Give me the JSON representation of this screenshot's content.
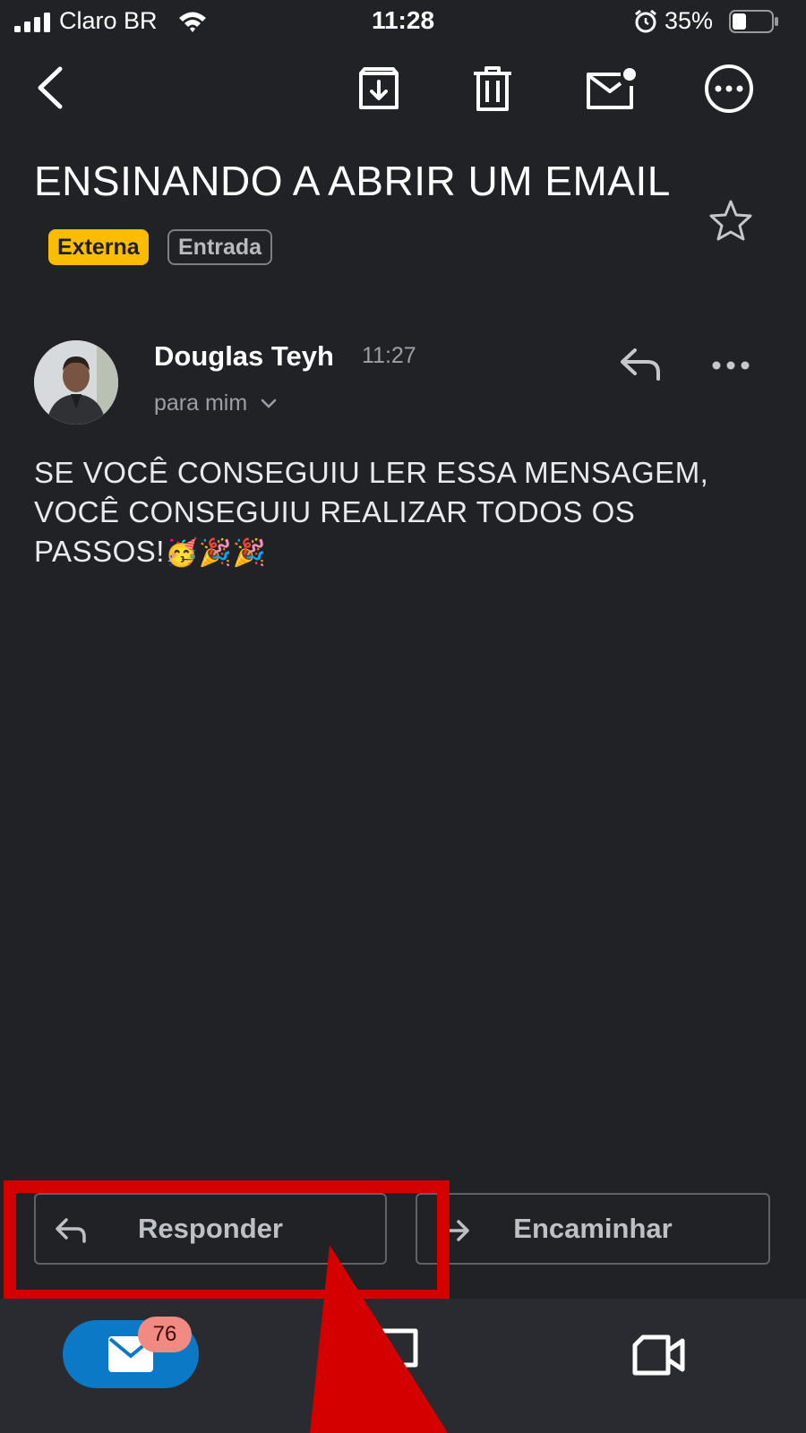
{
  "status_bar": {
    "carrier": "Claro BR",
    "time": "11:28",
    "battery": "35%",
    "battery_level": 0.35
  },
  "toolbar": {
    "icons": [
      "back-arrow-icon",
      "archive-icon",
      "trash-icon",
      "mark-unread-icon",
      "more-options-icon"
    ]
  },
  "email": {
    "subject": "ENSINANDO A ABRIR UM EMAIL",
    "labels": [
      "Externa",
      "Entrada"
    ],
    "sender": {
      "name": "Douglas Teyh",
      "time": "11:27",
      "recipient": "para mim"
    },
    "body": "SE VOCÊ CONSEGUIU LER ESSA MENSAGEM, VOCÊ CONSEGUIU REALIZAR TODOS OS PASSOS!",
    "body_emojis": "🥳🎉🎉"
  },
  "actions": {
    "reply_label": "Responder",
    "forward_label": "Encaminhar"
  },
  "bottom_nav": {
    "mail_count": "76",
    "items": [
      "mail-icon",
      "chat-icon",
      "meet-icon"
    ]
  },
  "colors": {
    "background": "#212226",
    "label_externa": "#fbbc04",
    "highlight": "#d40000",
    "mail_pill": "#0b79c6",
    "count_badge": "#f08a83"
  }
}
